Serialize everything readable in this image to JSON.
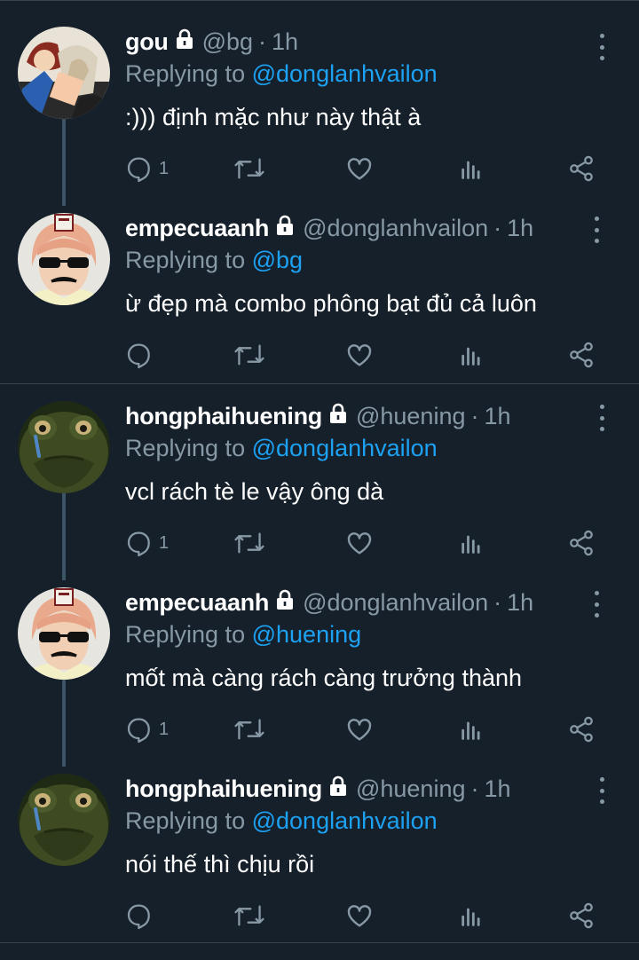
{
  "reply_prefix": "Replying to",
  "tweets": [
    {
      "name": "gou",
      "handle": "@bg",
      "time": "1h",
      "reply_to": "@donglanhvailon",
      "text": ":))) định mặc như này thật à",
      "reply_count": "1",
      "avatar": "cartoon-avatar"
    },
    {
      "name": "empecuaanh",
      "handle": "@donglanhvailon",
      "time": "1h",
      "reply_to": "@bg",
      "text": "ừ đẹp mà combo phông bạt đủ cả luôn",
      "reply_count": "",
      "avatar": "sunglasses-avatar"
    },
    {
      "name": "hongphaihuening",
      "handle": "@huening",
      "time": "1h",
      "reply_to": "@donglanhvailon",
      "text": "vcl rách tè le vậy ông dà",
      "reply_count": "1",
      "avatar": "frog-avatar"
    },
    {
      "name": "empecuaanh",
      "handle": "@donglanhvailon",
      "time": "1h",
      "reply_to": "@huening",
      "text": "mốt mà càng rách càng trưởng thành",
      "reply_count": "1",
      "avatar": "sunglasses-avatar"
    },
    {
      "name": "hongphaihuening",
      "handle": "@huening",
      "time": "1h",
      "reply_to": "@donglanhvailon",
      "text": "nói thế thì chịu rồi",
      "reply_count": "",
      "avatar": "frog-avatar"
    }
  ],
  "colors": {
    "background": "#15202b",
    "secondary_text": "#8899a6",
    "mention": "#1da1f2",
    "divider": "#38444d",
    "thread_line": "#3d5466"
  }
}
